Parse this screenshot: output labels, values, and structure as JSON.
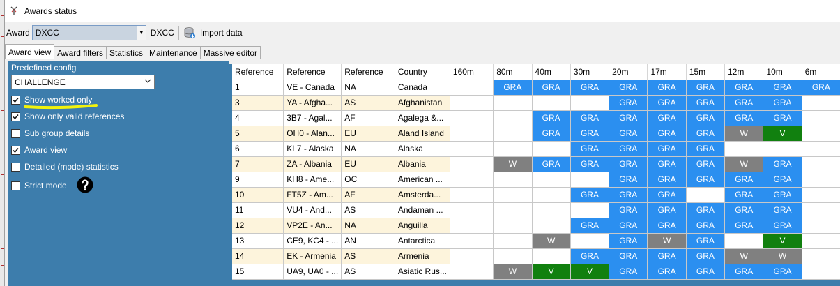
{
  "window": {
    "title": "Awards status"
  },
  "toolbar": {
    "award_label": "Award",
    "award_value": "DXCC",
    "award_name": "DXCC",
    "import_label": "Import data"
  },
  "tabs": [
    "Award view",
    "Award filters",
    "Statistics",
    "Maintenance",
    "Massive editor"
  ],
  "sidebar": {
    "predefined_label": "Predefined config",
    "predefined_value": "CHALLENGE",
    "options": [
      {
        "label": "Show worked only",
        "checked": true
      },
      {
        "label": "Show only valid references",
        "checked": true
      },
      {
        "label": "Sub group details",
        "checked": false
      },
      {
        "label": "Award view",
        "checked": true
      },
      {
        "label": "Detailed (mode) statistics",
        "checked": false
      },
      {
        "label": "Strict mode",
        "checked": false
      }
    ]
  },
  "grid": {
    "columns": [
      "Reference",
      "Reference",
      "Reference",
      "Country",
      "160m",
      "80m",
      "40m",
      "30m",
      "20m",
      "17m",
      "15m",
      "12m",
      "10m",
      "6m"
    ],
    "rows": [
      {
        "ref": "1",
        "prefix": "VE - Canada",
        "cont": "NA",
        "country": "Canada",
        "bands": [
          "",
          "GRA",
          "GRA",
          "GRA",
          "GRA",
          "GRA",
          "GRA",
          "GRA",
          "GRA",
          "GRA"
        ]
      },
      {
        "ref": "3",
        "prefix": "YA - Afgha...",
        "cont": "AS",
        "country": "Afghanistan",
        "bands": [
          "",
          "",
          "",
          "",
          "GRA",
          "GRA",
          "GRA",
          "GRA",
          "GRA",
          ""
        ]
      },
      {
        "ref": "4",
        "prefix": "3B7 - Agal...",
        "cont": "AF",
        "country": "Agalega &...",
        "bands": [
          "",
          "",
          "GRA",
          "GRA",
          "GRA",
          "GRA",
          "GRA",
          "GRA",
          "GRA",
          ""
        ]
      },
      {
        "ref": "5",
        "prefix": "OH0 - Alan...",
        "cont": "EU",
        "country": "Aland Island",
        "bands": [
          "",
          "",
          "GRA",
          "GRA",
          "GRA",
          "GRA",
          "GRA",
          "W",
          "V",
          ""
        ]
      },
      {
        "ref": "6",
        "prefix": "KL7 - Alaska",
        "cont": "NA",
        "country": "Alaska",
        "bands": [
          "",
          "",
          "",
          "GRA",
          "GRA",
          "GRA",
          "GRA",
          "",
          "",
          ""
        ]
      },
      {
        "ref": "7",
        "prefix": "ZA - Albania",
        "cont": "EU",
        "country": "Albania",
        "bands": [
          "",
          "W",
          "GRA",
          "GRA",
          "GRA",
          "GRA",
          "GRA",
          "W",
          "GRA",
          ""
        ]
      },
      {
        "ref": "9",
        "prefix": "KH8 - Ame...",
        "cont": "OC",
        "country": "American ...",
        "bands": [
          "",
          "",
          "",
          "",
          "GRA",
          "GRA",
          "GRA",
          "GRA",
          "GRA",
          ""
        ]
      },
      {
        "ref": "10",
        "prefix": "FT5Z - Am...",
        "cont": "AF",
        "country": "Amsterda...",
        "bands": [
          "",
          "",
          "",
          "GRA",
          "GRA",
          "GRA",
          "",
          "GRA",
          "GRA",
          ""
        ]
      },
      {
        "ref": "11",
        "prefix": "VU4 - And...",
        "cont": "AS",
        "country": "Andaman ...",
        "bands": [
          "",
          "",
          "",
          "",
          "GRA",
          "GRA",
          "GRA",
          "GRA",
          "GRA",
          ""
        ]
      },
      {
        "ref": "12",
        "prefix": "VP2E - An...",
        "cont": "NA",
        "country": "Anguilla",
        "bands": [
          "",
          "",
          "",
          "GRA",
          "GRA",
          "GRA",
          "GRA",
          "GRA",
          "GRA",
          ""
        ]
      },
      {
        "ref": "13",
        "prefix": "CE9, KC4 - ...",
        "cont": "AN",
        "country": "Antarctica",
        "bands": [
          "",
          "",
          "W",
          "",
          "GRA",
          "W",
          "GRA",
          "",
          "V",
          ""
        ]
      },
      {
        "ref": "14",
        "prefix": "EK - Armenia",
        "cont": "AS",
        "country": "Armenia",
        "bands": [
          "",
          "",
          "",
          "GRA",
          "GRA",
          "GRA",
          "GRA",
          "W",
          "W",
          ""
        ]
      },
      {
        "ref": "15",
        "prefix": "UA9, UA0 - ...",
        "cont": "AS",
        "country": "Asiatic Rus...",
        "bands": [
          "",
          "W",
          "V",
          "V",
          "GRA",
          "GRA",
          "GRA",
          "GRA",
          "GRA",
          ""
        ]
      }
    ]
  },
  "colors": {
    "panel": "#3d7dac",
    "gra": "#2b8ff0",
    "worked": "#808080",
    "validated": "#11800f",
    "alt_row": "#fdf4dc"
  },
  "icons": {
    "app": "antenna-icon",
    "import": "database-icon",
    "help": "help-icon"
  }
}
